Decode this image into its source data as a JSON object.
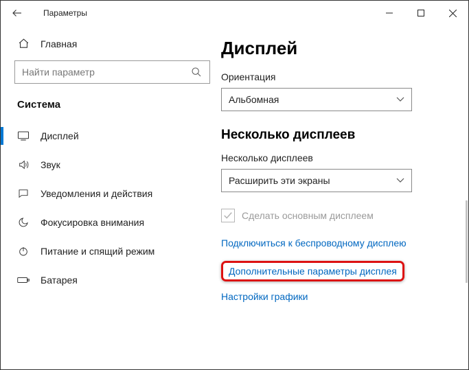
{
  "window": {
    "title": "Параметры"
  },
  "sidebar": {
    "home": "Главная",
    "search_placeholder": "Найти параметр",
    "section": "Система",
    "items": [
      {
        "label": "Дисплей"
      },
      {
        "label": "Звук"
      },
      {
        "label": "Уведомления и действия"
      },
      {
        "label": "Фокусировка внимания"
      },
      {
        "label": "Питание и спящий режим"
      },
      {
        "label": "Батарея"
      }
    ]
  },
  "content": {
    "heading": "Дисплей",
    "orientation_label": "Ориентация",
    "orientation_value": "Альбомная",
    "multi_heading": "Несколько дисплеев",
    "multi_label": "Несколько дисплеев",
    "multi_value": "Расширить эти экраны",
    "checkbox_label": "Сделать основным дисплеем",
    "links": {
      "wireless": "Подключиться к беспроводному дисплею",
      "advanced": "Дополнительные параметры дисплея",
      "graphics": "Настройки графики"
    }
  }
}
